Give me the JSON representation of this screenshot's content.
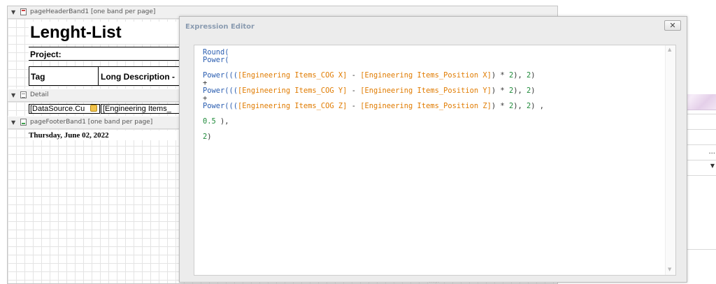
{
  "report": {
    "header_band": {
      "label": "pageHeaderBand1 [one band per page]"
    },
    "title": "Lenght-List",
    "project_label": "Project:",
    "columns": {
      "tag": "Tag",
      "long_description": "Long Description -"
    },
    "detail_band": {
      "label": "Detail"
    },
    "detail_cells": {
      "datasource": "[DataSource.Cu",
      "engineering_items": "[Engineering Items_"
    },
    "footer_band": {
      "label": "pageFooterBand1 [one band per page]"
    },
    "date": "Thursday, June 02, 2022"
  },
  "editor": {
    "title": "Expression Editor",
    "close_label": "✕",
    "grip": "......",
    "code": {
      "l1": "Round(",
      "l2": "Power(",
      "p": "Power(((",
      "cog_x": "[Engineering Items_COG X]",
      "pos_x": "[Engineering Items_Position X]",
      "cog_y": "[Engineering Items_COG Y]",
      "pos_y": "[Engineering Items_Position Y]",
      "cog_z": "[Engineering Items_COG Z]",
      "pos_z": "[Engineering Items_Position Z]",
      "minus": " - ",
      "close_mul": ") * ",
      "two": "2",
      "mid": "), ",
      "end": ")",
      "end_comma": ") ,",
      "plus": "+",
      "half": "0.5",
      "half_close": " ),",
      "final_close": ")"
    }
  },
  "background_panel": {
    "ellipsis": "...",
    "dropdown": "▼"
  }
}
